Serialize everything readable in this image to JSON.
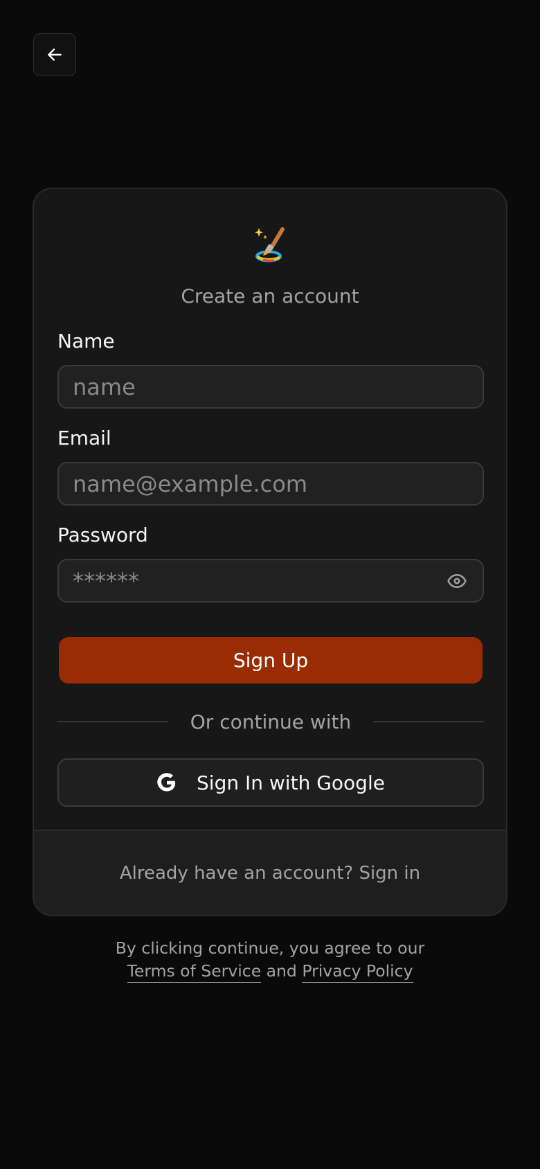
{
  "nav": {
    "back_icon": "arrow-left-icon"
  },
  "card": {
    "logo_icon": "paintbrush-sparkles-icon",
    "heading": "Create an account",
    "fields": {
      "name": {
        "label": "Name",
        "placeholder": "name"
      },
      "email": {
        "label": "Email",
        "placeholder": "name@example.com"
      },
      "password": {
        "label": "Password",
        "placeholder": "******",
        "toggle_icon": "eye-icon"
      }
    },
    "signup_label": "Sign Up",
    "divider_text": "Or continue with",
    "google": {
      "label": "Sign In with Google",
      "icon": "google-icon"
    },
    "footer_text": "Already have an account? Sign in"
  },
  "legal": {
    "prefix": "By clicking continue, you agree to our",
    "terms_link": "Terms of Service",
    "conjunction": "and",
    "privacy_link": "Privacy Policy"
  },
  "colors": {
    "background": "#0a0a0a",
    "card": "#171717",
    "accent": "#9a2c03",
    "muted_text": "#a3a3a3"
  }
}
